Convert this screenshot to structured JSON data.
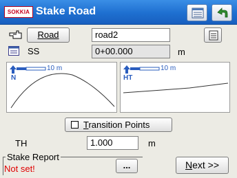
{
  "titlebar": {
    "logo": "SOKKIA",
    "title": "Stake Road"
  },
  "road": {
    "button_label": "Road",
    "value": "road2"
  },
  "ss": {
    "label": "SS",
    "value": "0+00.000",
    "unit": "m"
  },
  "plots": {
    "left": {
      "scale": "10 m",
      "axis_label": "N"
    },
    "right": {
      "scale": "10 m",
      "axis_label": "HT"
    }
  },
  "transition": {
    "label": "Transition Points",
    "checked": false
  },
  "th": {
    "label": "TH",
    "value": "1.000",
    "unit": "m"
  },
  "stake_report": {
    "title": "Stake Report",
    "status": "Not set!",
    "browse_label": "..."
  },
  "next_button": "Next >>",
  "colors": {
    "titlebar": "#1e6fd0",
    "status_error": "#e00000",
    "accent_blue": "#2a5dbe"
  }
}
